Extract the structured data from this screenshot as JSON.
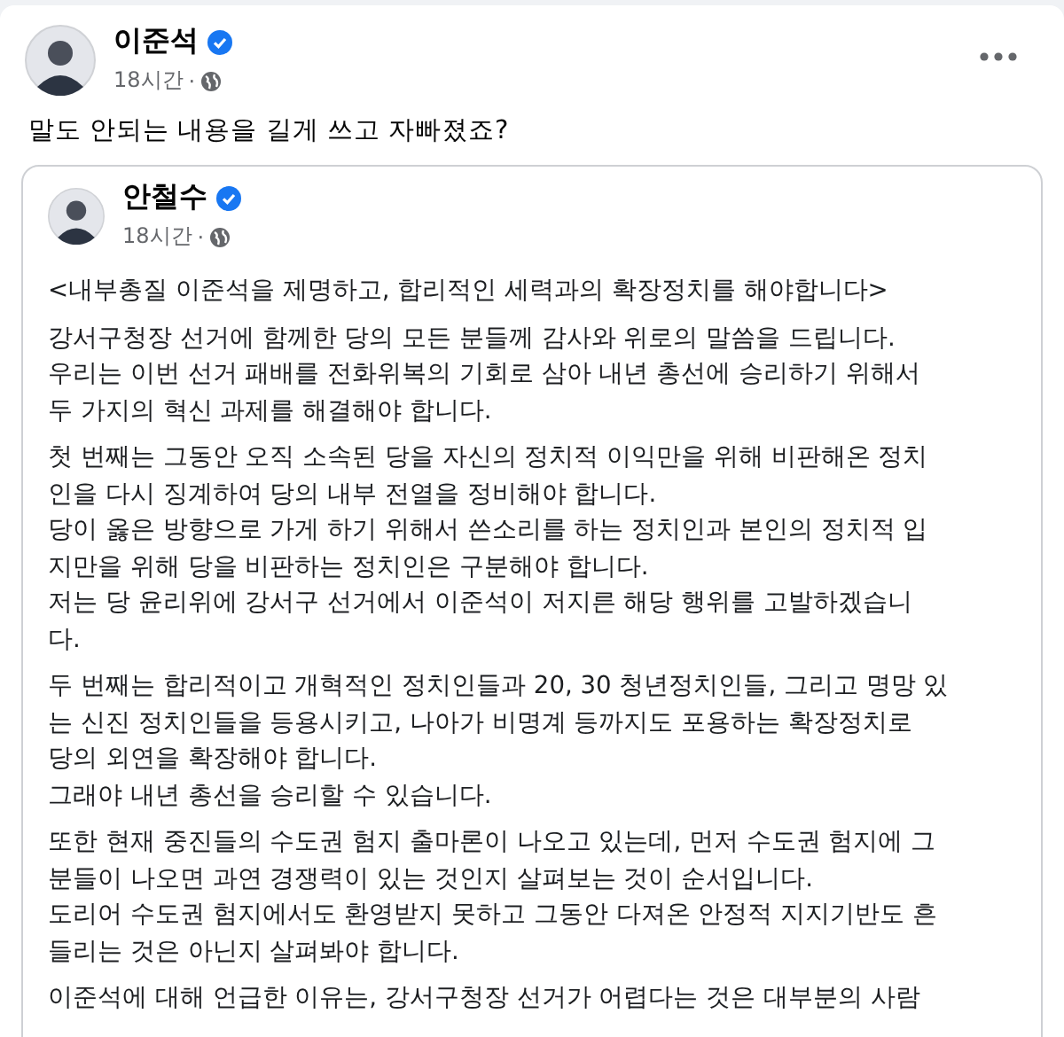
{
  "post": {
    "author": "이준석",
    "verified": true,
    "time": "18시간",
    "separator": "·",
    "caption": "말도 안되는 내용을 길게 쓰고 자빠졌죠?"
  },
  "shared_post": {
    "author": "안철수",
    "verified": true,
    "time": "18시간",
    "separator": "·",
    "paragraphs": [
      [
        "<내부총질 이준석을 제명하고, 합리적인 세력과의 확장정치를 해야합니다>"
      ],
      [
        "강서구청장 선거에 함께한 당의 모든 분들께 감사와 위로의 말씀을 드립니다.",
        "우리는 이번 선거 패배를 전화위복의 기회로 삼아 내년 총선에 승리하기 위해서",
        "두 가지의 혁신 과제를 해결해야 합니다."
      ],
      [
        "첫 번째는 그동안 오직 소속된 당을 자신의 정치적 이익만을 위해 비판해온 정치",
        "인을 다시 징계하여 당의 내부 전열을 정비해야 합니다.",
        "당이 옳은 방향으로 가게 하기 위해서 쓴소리를 하는 정치인과 본인의 정치적 입",
        "지만을 위해 당을 비판하는 정치인은 구분해야 합니다.",
        "저는 당 윤리위에 강서구 선거에서 이준석이 저지른 해당 행위를 고발하겠습니",
        "다."
      ],
      [
        "두 번째는 합리적이고 개혁적인 정치인들과 20, 30 청년정치인들, 그리고 명망 있",
        "는 신진 정치인들을 등용시키고, 나아가 비명계 등까지도 포용하는 확장정치로",
        "당의 외연을 확장해야 합니다.",
        "그래야 내년 총선을 승리할 수 있습니다."
      ],
      [
        "또한 현재 중진들의 수도권 험지 출마론이 나오고 있는데, 먼저 수도권 험지에 그",
        "분들이 나오면 과연 경쟁력이 있는 것인지 살펴보는 것이 순서입니다.",
        "도리어 수도권 험지에서도 환영받지 못하고 그동안 다져온 안정적 지지기반도 흔",
        "들리는 것은 아닌지 살펴봐야 합니다."
      ],
      [
        "이준석에 대해 언급한 이유는, 강서구청장 선거가 어렵다는 것은 대부분의 사람"
      ]
    ]
  }
}
